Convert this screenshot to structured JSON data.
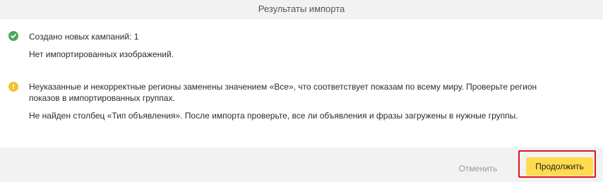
{
  "dialog": {
    "title": "Результаты импорта"
  },
  "messages": {
    "success": {
      "icon": "check-circle-icon",
      "color": "#4aa85c",
      "line1": "Создано новых кампаний: 1",
      "line2": "Нет импортированных изображений."
    },
    "info": {
      "icon": "info-circle-icon",
      "color": "#f2c230",
      "line1": "Неуказанные и некорректные регионы заменены значением «Все», что соответствует показам по всему миру. Проверьте регион",
      "line2": "показов в импортированных группах.",
      "line3": "Не найден столбец «Тип объявления». После импорта проверьте, все ли объявления и фразы загружены в нужные группы."
    }
  },
  "footer": {
    "cancel_label": "Отменить",
    "continue_label": "Продолжить",
    "accent_color": "#ffdb4d",
    "highlight_color": "#e0151e"
  }
}
